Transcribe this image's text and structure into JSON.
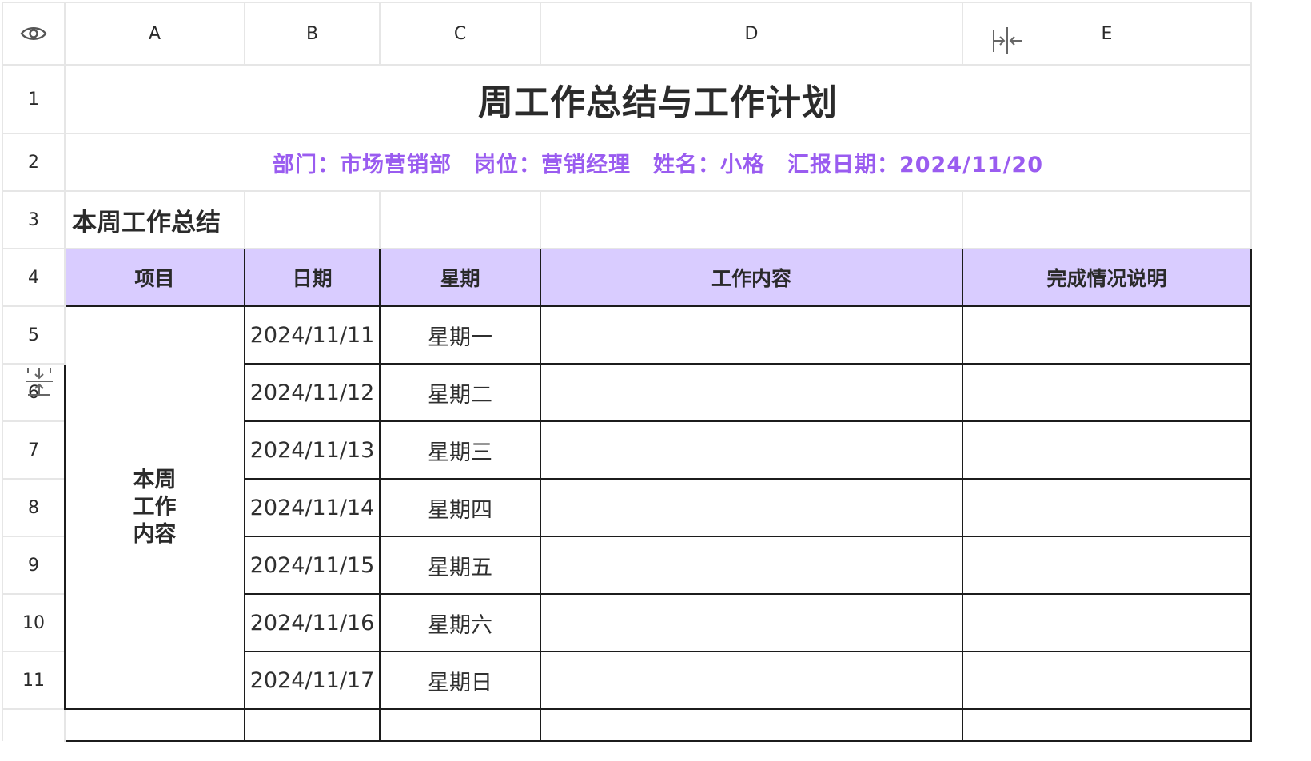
{
  "columns": {
    "A": "A",
    "B": "B",
    "C": "C",
    "D": "D",
    "E": "E"
  },
  "rows": [
    "1",
    "2",
    "3",
    "4",
    "5",
    "6",
    "7",
    "8",
    "9",
    "10",
    "11"
  ],
  "title": "周工作总结与工作计划",
  "info": {
    "department": "部门：市场营销部",
    "position": "岗位：营销经理",
    "name": "姓名：小格",
    "report_date": "汇报日期：2024/11/20"
  },
  "section_title": "本周工作总结",
  "table_headers": [
    "项目",
    "日期",
    "星期",
    "工作内容",
    "完成情况说明"
  ],
  "item_label": "本周\n工作\n内容",
  "entries": [
    {
      "date": "2024/11/11",
      "weekday": "星期一",
      "content": "",
      "status": ""
    },
    {
      "date": "2024/11/12",
      "weekday": "星期二",
      "content": "",
      "status": ""
    },
    {
      "date": "2024/11/13",
      "weekday": "星期三",
      "content": "",
      "status": ""
    },
    {
      "date": "2024/11/14",
      "weekday": "星期四",
      "content": "",
      "status": ""
    },
    {
      "date": "2024/11/15",
      "weekday": "星期五",
      "content": "",
      "status": ""
    },
    {
      "date": "2024/11/16",
      "weekday": "星期六",
      "content": "",
      "status": ""
    },
    {
      "date": "2024/11/17",
      "weekday": "星期日",
      "content": "",
      "status": ""
    }
  ],
  "icons": {
    "corner": "eye-icon",
    "column_resize": "column-collapse-icon",
    "row_resize": "row-collapse-icon"
  },
  "colors": {
    "header_fill": "#d9ccff",
    "info_text": "#9a5cf0",
    "grid_line": "#e6e6e6",
    "table_border": "#1c1c1c"
  }
}
